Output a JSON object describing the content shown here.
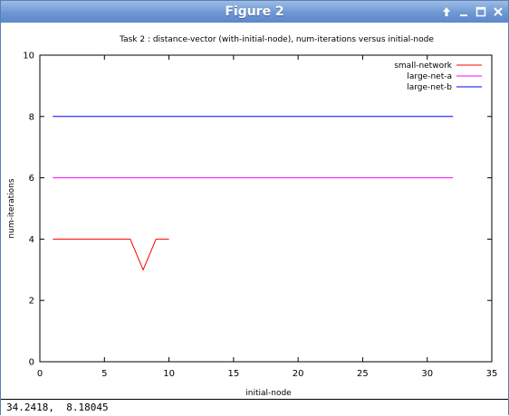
{
  "window": {
    "title": "Figure 2",
    "buttons": [
      "pin",
      "minimize",
      "maximize",
      "close"
    ]
  },
  "status": {
    "coords": "34.2418,  8.18045"
  },
  "chart_data": {
    "type": "line",
    "title": "Task 2 : distance-vector (with-initial-node), num-iterations versus initial-node",
    "xlabel": "initial-node",
    "ylabel": "num-iterations",
    "xlim": [
      0,
      35
    ],
    "ylim": [
      0,
      10
    ],
    "xticks": [
      0,
      5,
      10,
      15,
      20,
      25,
      30,
      35
    ],
    "yticks": [
      0,
      2,
      4,
      6,
      8,
      10
    ],
    "grid": false,
    "legend": "top-right",
    "series": [
      {
        "name": "small-network",
        "color": "#ff0000",
        "x": [
          1,
          2,
          3,
          4,
          5,
          6,
          7,
          8,
          9,
          10
        ],
        "y": [
          4,
          4,
          4,
          4,
          4,
          4,
          4,
          3,
          4,
          4
        ]
      },
      {
        "name": "large-net-a",
        "color": "#ff00ff",
        "x": [
          1,
          2,
          3,
          4,
          5,
          6,
          7,
          8,
          9,
          10,
          11,
          12,
          13,
          14,
          15,
          16,
          17,
          18,
          19,
          20,
          21,
          22,
          23,
          24,
          25,
          26,
          27,
          28,
          29,
          30,
          31,
          32
        ],
        "y": [
          6,
          6,
          6,
          6,
          6,
          6,
          6,
          6,
          6,
          6,
          6,
          6,
          6,
          6,
          6,
          6,
          6,
          6,
          6,
          6,
          6,
          6,
          6,
          6,
          6,
          6,
          6,
          6,
          6,
          6,
          6,
          6
        ]
      },
      {
        "name": "large-net-b",
        "color": "#0000ff",
        "x": [
          1,
          2,
          3,
          4,
          5,
          6,
          7,
          8,
          9,
          10,
          11,
          12,
          13,
          14,
          15,
          16,
          17,
          18,
          19,
          20,
          21,
          22,
          23,
          24,
          25,
          26,
          27,
          28,
          29,
          30,
          31,
          32
        ],
        "y": [
          8,
          8,
          8,
          8,
          8,
          8,
          8,
          8,
          8,
          8,
          8,
          8,
          8,
          8,
          8,
          8,
          8,
          8,
          8,
          8,
          8,
          8,
          8,
          8,
          8,
          8,
          8,
          8,
          8,
          8,
          8,
          8
        ]
      }
    ]
  }
}
